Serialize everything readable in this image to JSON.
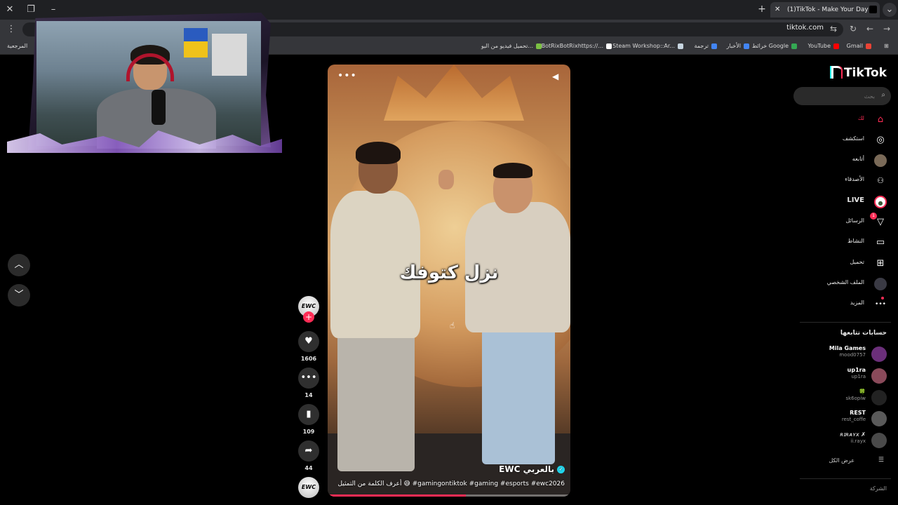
{
  "browser": {
    "tab_title": "(1)TikTok - Make Your Day",
    "url": "tiktok.com",
    "bookmarks": [
      {
        "label": "Gmail",
        "color": "#ea4335"
      },
      {
        "label": "YouTube",
        "color": "#ff0000"
      },
      {
        "label": "خرائط Google",
        "color": "#34a853"
      },
      {
        "label": "الأخبار",
        "color": "#4285f4"
      },
      {
        "label": "ترجمة",
        "color": "#4285f4"
      },
      {
        "label": "Steam Workshop::Ar...",
        "color": "#1b2838"
      },
      {
        "label": "BotRixBotRixhttps://...",
        "color": "#ffffff"
      },
      {
        "label": "تحميل فيديو من اليو...",
        "color": "#7bc043"
      },
      {
        "label": "المرجعية",
        "color": ""
      }
    ]
  },
  "video": {
    "caption_overlay": "نزل كتوفك",
    "author": "EWC بالعربي",
    "description": "أعرف الكلمة من التمثيل 😅 #gamingontiktok #gaming #esports #ewc2026",
    "progress": 0.57
  },
  "actions": {
    "avatar_text": "EWC",
    "likes": "1606",
    "comments": "14",
    "bookmarks": "109",
    "shares": "44"
  },
  "sidebar": {
    "logo": "TikTok",
    "search_placeholder": "بحث",
    "nav": [
      {
        "label": "لك",
        "icon": "home-icon",
        "glyph": "⌂",
        "active": true
      },
      {
        "label": "استكشف",
        "icon": "compass-icon",
        "glyph": "◎"
      },
      {
        "label": "أتابعه",
        "icon": "following-avatar-icon",
        "glyph": "●"
      },
      {
        "label": "الأصدقاء",
        "icon": "friends-icon",
        "glyph": "👥"
      },
      {
        "label": "LIVE",
        "icon": "live-icon",
        "glyph": "⦿"
      },
      {
        "label": "الرسائل",
        "icon": "messages-icon",
        "glyph": "➢",
        "badge": "1"
      },
      {
        "label": "النشاط",
        "icon": "activity-icon",
        "glyph": "▭"
      },
      {
        "label": "تحميل",
        "icon": "upload-icon",
        "glyph": "⊞"
      },
      {
        "label": "الملف الشخصي",
        "icon": "profile-icon",
        "glyph": "●"
      },
      {
        "label": "المزيد",
        "icon": "more-icon",
        "glyph": "•••"
      }
    ],
    "following_title": "حسابات تتابعها",
    "following": [
      {
        "name": "Mila Games",
        "handle": "mood0757",
        "color": "#6b2f7a"
      },
      {
        "name": "up1ra",
        "handle": "up1ra",
        "color": "#8a4a5a"
      },
      {
        "name": "🍀",
        "handle": "sk6opiw",
        "color": "#333333"
      },
      {
        "name": "REST",
        "handle": "rest_coffe",
        "color": "#5a5a5a"
      },
      {
        "name": "ʀɪʀᴀʏx ✗",
        "handle": "ii.rayx",
        "color": "#4a4a4a"
      }
    ],
    "see_all": "عرض الكل",
    "footer": "الشركة"
  }
}
